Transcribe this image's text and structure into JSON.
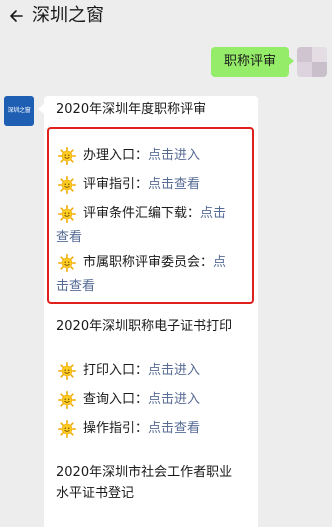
{
  "header": {
    "title": "深圳之窗",
    "back_icon": "back-arrow-icon"
  },
  "outgoing": {
    "text": "职称评审"
  },
  "official": {
    "avatar_text": "深圳之窗"
  },
  "message": {
    "heading1": "2020年深圳年度职称评审",
    "items1": [
      {
        "label": "办理入口：",
        "link": "点击进入"
      },
      {
        "label": "评审指引：",
        "link": "点击查看"
      },
      {
        "label": "评审条件汇编下载：",
        "link_part1": "点击",
        "link_part2": "查看"
      },
      {
        "label": "市属职称评审委员会：",
        "link_part1": "点",
        "link_part2": "击查看"
      }
    ],
    "heading2": "2020年深圳职称电子证书打印",
    "items2": [
      {
        "label": "打印入口：",
        "link": "点击进入"
      },
      {
        "label": "查询入口：",
        "link": "点击进入"
      },
      {
        "label": "操作指引：",
        "link": "点击查看"
      }
    ],
    "heading3_line1": "2020年深圳市社会工作者职业",
    "heading3_line2": "水平证书登记"
  },
  "colors": {
    "link": "#576b95",
    "highlight": "#e0201c",
    "bubble_out": "#95ec69"
  }
}
